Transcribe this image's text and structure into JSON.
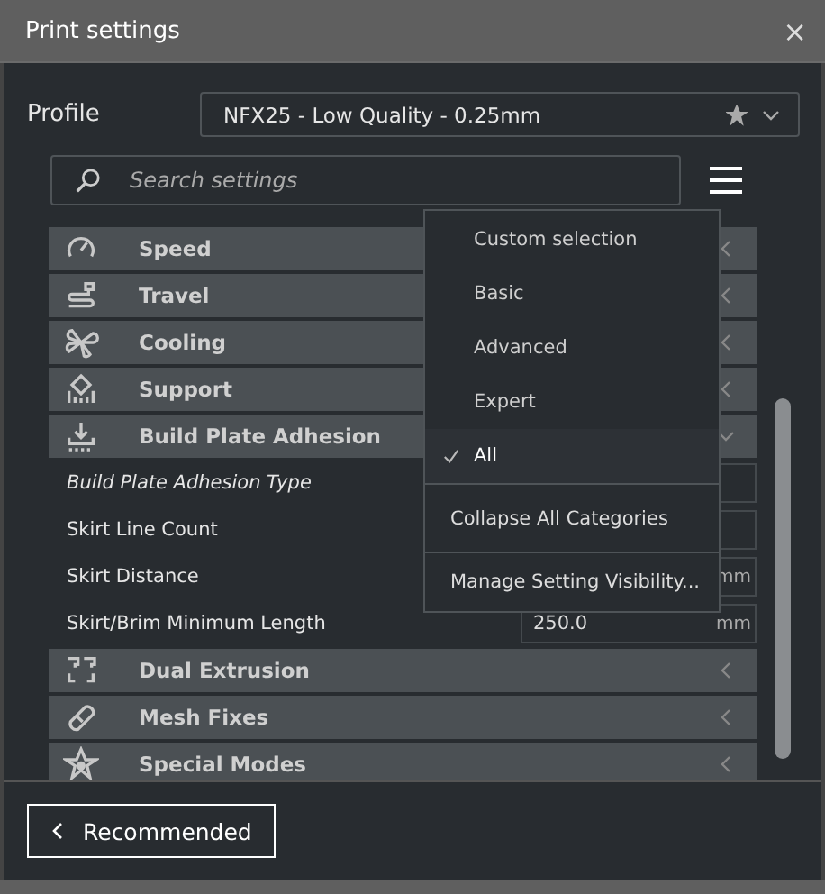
{
  "window": {
    "title": "Print settings",
    "close": "×"
  },
  "profile": {
    "label": "Profile",
    "value": "NFX25 - Low Quality - 0.25mm",
    "starred": true
  },
  "search": {
    "placeholder": "Search settings"
  },
  "categories_top": [
    {
      "label": "Speed",
      "kind": "speed",
      "expanded": false
    },
    {
      "label": "Travel",
      "kind": "travel",
      "expanded": false
    },
    {
      "label": "Cooling",
      "kind": "cooling",
      "expanded": false
    },
    {
      "label": "Support",
      "kind": "support",
      "expanded": false
    },
    {
      "label": "Build Plate Adhesion",
      "kind": "adhesion",
      "expanded": true
    }
  ],
  "settings": [
    {
      "label": "Build Plate Adhesion Type",
      "italic": true
    },
    {
      "label": "Skirt Line Count",
      "italic": false
    },
    {
      "label": "Skirt Distance",
      "unit": "mm",
      "italic": false
    },
    {
      "label": "Skirt/Brim Minimum Length",
      "value": "250.0",
      "unit": "mm",
      "italic": false
    }
  ],
  "categories_bottom": [
    {
      "label": "Dual Extrusion",
      "kind": "dual",
      "expanded": false
    },
    {
      "label": "Mesh Fixes",
      "kind": "mesh",
      "expanded": false
    },
    {
      "label": "Special Modes",
      "kind": "special",
      "expanded": false
    }
  ],
  "visibility_menu": {
    "options": [
      {
        "label": "Custom selection",
        "selected": false
      },
      {
        "label": "Basic",
        "selected": false
      },
      {
        "label": "Advanced",
        "selected": false
      },
      {
        "label": "Expert",
        "selected": false
      },
      {
        "label": "All",
        "selected": true
      }
    ],
    "actions": [
      "Collapse All Categories",
      "Manage Setting Visibility..."
    ]
  },
  "footer": {
    "button": "Recommended"
  }
}
